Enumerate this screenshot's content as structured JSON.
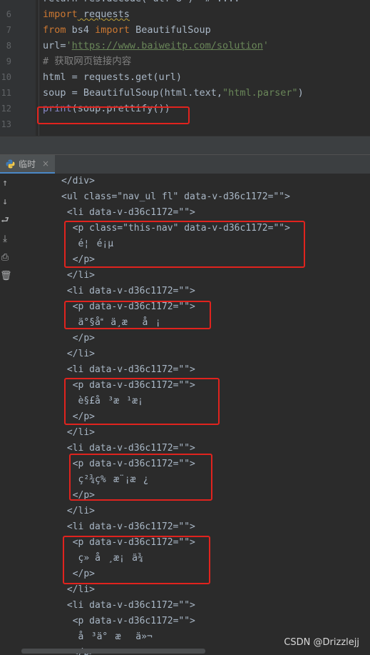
{
  "editor": {
    "lines": [
      {
        "num": "",
        "partial": "return res.decode('utf-8')  # ...."
      },
      {
        "num": "6",
        "tokens": [
          [
            "kw",
            "import"
          ],
          [
            "plain",
            " requests"
          ]
        ],
        "squiggle": true
      },
      {
        "num": "7",
        "tokens": [
          [
            "kw",
            "from"
          ],
          [
            "plain",
            " bs4 "
          ],
          [
            "kw",
            "import"
          ],
          [
            "plain",
            " BeautifulSoup"
          ]
        ]
      },
      {
        "num": "8",
        "tokens": [
          [
            "plain",
            "url="
          ],
          [
            "str",
            "'"
          ],
          [
            "url",
            "https://www.baiweitp.com/solution"
          ],
          [
            "str",
            "'"
          ]
        ]
      },
      {
        "num": "9",
        "tokens": [
          [
            "cm",
            "# 获取网页链接内容"
          ]
        ]
      },
      {
        "num": "10",
        "tokens": [
          [
            "plain",
            "html = requests.get(url)"
          ]
        ]
      },
      {
        "num": "11",
        "tokens": [
          [
            "plain",
            "soup = BeautifulSoup(html.text"
          ],
          [
            "plain",
            ","
          ],
          [
            "str",
            "\"html.parser\""
          ],
          [
            "plain",
            ")"
          ]
        ]
      },
      {
        "num": "12",
        "tokens": [
          [
            "fn",
            "print"
          ],
          [
            "plain",
            "(soup.prettify())"
          ]
        ]
      },
      {
        "num": "13",
        "tokens": [
          [
            "plain",
            ""
          ]
        ]
      }
    ]
  },
  "run_panel": {
    "tab_label": "临时",
    "tab_close": "×"
  },
  "toolbar_icons": [
    "up-arrow-icon",
    "down-arrow-icon",
    "soft-wrap-icon",
    "scroll-to-end-icon",
    "print-icon",
    "trash-icon"
  ],
  "console": {
    "lines": [
      {
        "indent": 7,
        "text": "</div>"
      },
      {
        "indent": 7,
        "text": "<ul class=\"nav_ul fl\" data-v-d36c1172=\"\">"
      },
      {
        "indent": 8,
        "text": "<li data-v-d36c1172=\"\">"
      },
      {
        "indent": 9,
        "text": "<p class=\"this-nav\" data-v-d36c1172=\"\">"
      },
      {
        "indent": 10,
        "text": "é¦é¡µ"
      },
      {
        "indent": 9,
        "text": "</p>"
      },
      {
        "indent": 8,
        "text": "</li>"
      },
      {
        "indent": 8,
        "text": "<li data-v-d36c1172=\"\">"
      },
      {
        "indent": 9,
        "text": "<p data-v-d36c1172=\"\">"
      },
      {
        "indent": 10,
        "text": "ä°§åä¸­æå¡"
      },
      {
        "indent": 9,
        "text": "</p>"
      },
      {
        "indent": 8,
        "text": "</li>"
      },
      {
        "indent": 8,
        "text": "<li data-v-d36c1172=\"\">"
      },
      {
        "indent": 9,
        "text": "<p data-v-d36c1172=\"\">"
      },
      {
        "indent": 10,
        "text": "è§£å³æ¹æ¡"
      },
      {
        "indent": 9,
        "text": "</p>"
      },
      {
        "indent": 8,
        "text": "</li>"
      },
      {
        "indent": 8,
        "text": "<li data-v-d36c1172=\"\">"
      },
      {
        "indent": 9,
        "text": "<p data-v-d36c1172=\"\">"
      },
      {
        "indent": 10,
        "text": "ç²¾ç%æ¨¡æ¿"
      },
      {
        "indent": 9,
        "text": "</p>"
      },
      {
        "indent": 8,
        "text": "</li>"
      },
      {
        "indent": 8,
        "text": "<li data-v-d36c1172=\"\">"
      },
      {
        "indent": 9,
        "text": "<p data-v-d36c1172=\"\">"
      },
      {
        "indent": 10,
        "text": "ç»å¸æ¡ä¾"
      },
      {
        "indent": 9,
        "text": "</p>"
      },
      {
        "indent": 8,
        "text": "</li>"
      },
      {
        "indent": 8,
        "text": "<li data-v-d36c1172=\"\">"
      },
      {
        "indent": 9,
        "text": "<p data-v-d36c1172=\"\">"
      },
      {
        "indent": 10,
        "text": "å³ä°æä»¬"
      },
      {
        "indent": 9,
        "text": "</p>"
      }
    ]
  },
  "watermark": "CSDN @Drizzlejj",
  "colors": {
    "highlight_box": "#e0231e",
    "tab_accent": "#4a88c7"
  }
}
